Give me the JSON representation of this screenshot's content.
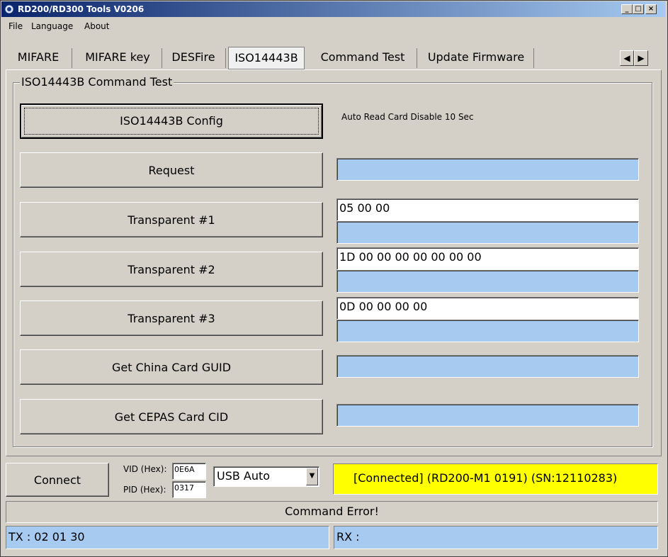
{
  "window": {
    "title": "RD200/RD300 Tools V0206",
    "min_glyph": "_",
    "max_glyph": "□",
    "close_glyph": "×"
  },
  "menu": {
    "file": "File",
    "language": "Language",
    "about": "About"
  },
  "tabs": [
    "MIFARE",
    "MIFARE key",
    "DESFire",
    "ISO14443B",
    "Command Test",
    "Update Firmware"
  ],
  "tab_scroll": {
    "left": "◀",
    "right": "▶"
  },
  "group": {
    "title": "ISO14443B Command Test"
  },
  "config": {
    "button_label": "ISO14443B Config",
    "note": "Auto Read Card Disable 10 Sec"
  },
  "commands": {
    "request": {
      "label": "Request",
      "result": ""
    },
    "transparent1": {
      "label": "Transparent #1",
      "input": "05 00 00",
      "result": ""
    },
    "transparent2": {
      "label": "Transparent #2",
      "input": "1D 00 00 00 00 00 00 00",
      "result": ""
    },
    "transparent3": {
      "label": "Transparent #3",
      "input": "0D 00 00 00 00",
      "result": ""
    },
    "china_guid": {
      "label": "Get China Card GUID",
      "result": ""
    },
    "cepas_cid": {
      "label": "Get CEPAS Card CID",
      "result": ""
    }
  },
  "connection": {
    "connect_label": "Connect",
    "vid_label": "VID (Hex):",
    "vid_value": "0E6A",
    "pid_label": "PID (Hex):",
    "pid_value": "0317",
    "mode_value": "USB Auto",
    "dropdown_glyph": "▼",
    "status": "[Connected] (RD200-M1     0191) (SN:12110283)"
  },
  "message": "Command Error!",
  "tx": "TX : 02 01 30",
  "rx": "RX :",
  "colors": {
    "field_blue": "#a6caf0",
    "status_yellow": "#ffff00",
    "title_gradient_start": "#0a246a"
  }
}
